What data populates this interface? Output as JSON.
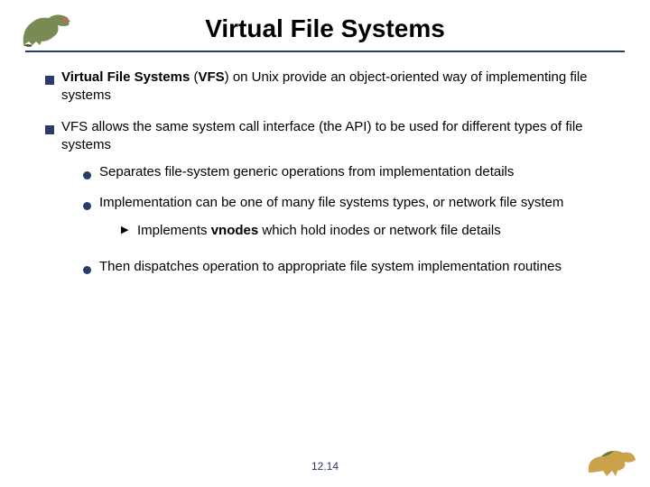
{
  "title": "Virtual File Systems",
  "bullets": {
    "p1": {
      "r1": "Virtual File Systems",
      "r2": " (",
      "r3": "VFS",
      "r4": ") on Unix provide an object-oriented way of implementing file systems"
    },
    "p2": {
      "r1": "VFS allows the same system call interface (the API) to be used for different types of file systems",
      "s1": "Separates file-system generic operations from implementation details",
      "s2": "Implementation can be one of many file systems types, or network file system",
      "s2a": {
        "r1": "Implements ",
        "r2": "vnodes",
        "r3": " which hold inodes or network file details"
      },
      "s3": "Then dispatches operation to appropriate file system implementation routines"
    }
  },
  "page": "12.14"
}
